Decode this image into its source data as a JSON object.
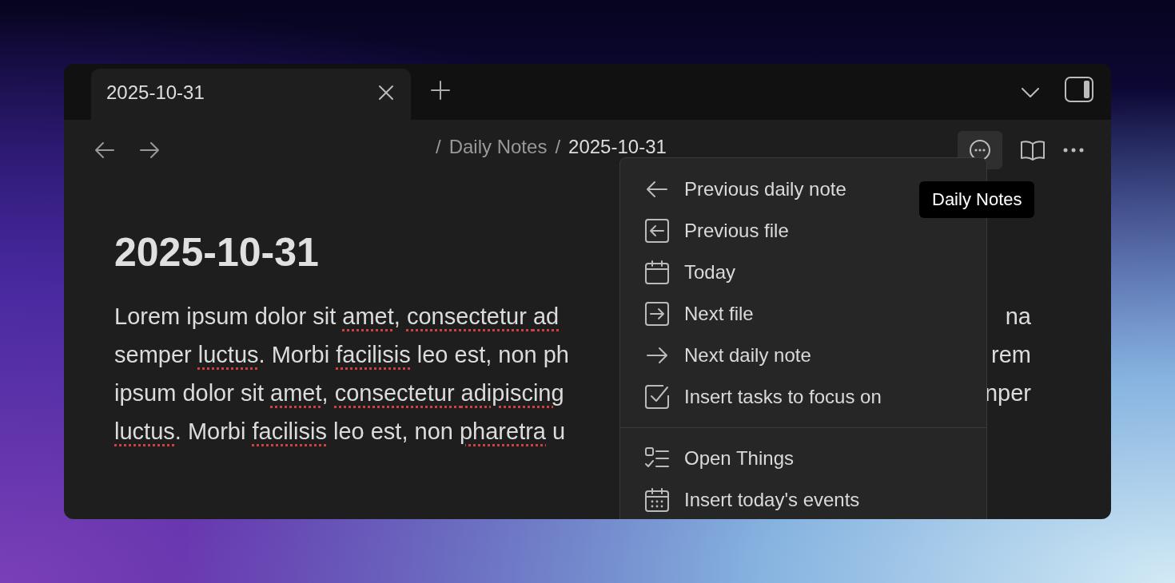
{
  "tabs": [
    {
      "title": "2025-10-31",
      "selected": true
    }
  ],
  "toolbar": {
    "breadcrumb": [
      "/",
      "Daily Notes",
      "/",
      "2025-10-31"
    ],
    "daily_notes_button_active": true,
    "tooltip": "Daily Notes"
  },
  "note": {
    "heading": "2025-10-31",
    "lines": [
      {
        "left": [
          {
            "text": "Lorem ipsum dolor sit ",
            "misspelled": false
          },
          {
            "text": "amet",
            "misspelled": true
          },
          {
            "text": ", ",
            "misspelled": false
          },
          {
            "text": "consectetur ",
            "misspelled": true
          },
          {
            "text": "ad",
            "misspelled": true
          }
        ],
        "right": "na"
      },
      {
        "left": [
          {
            "text": "semper ",
            "misspelled": false
          },
          {
            "text": "luctus",
            "misspelled": true
          },
          {
            "text": ". Morbi ",
            "misspelled": false
          },
          {
            "text": "facilisis",
            "misspelled": true
          },
          {
            "text": " leo est, non ph",
            "misspelled": false
          }
        ],
        "right": "rem"
      },
      {
        "left": [
          {
            "text": "ipsum dolor sit ",
            "misspelled": false
          },
          {
            "text": "amet",
            "misspelled": true
          },
          {
            "text": ", ",
            "misspelled": false
          },
          {
            "text": "consectetur ",
            "misspelled": true
          },
          {
            "text": "adipiscing",
            "misspelled": true
          }
        ],
        "right": "nper"
      },
      {
        "left": [
          {
            "text": "luctus",
            "misspelled": true
          },
          {
            "text": ". Morbi ",
            "misspelled": false
          },
          {
            "text": "facilisis",
            "misspelled": true
          },
          {
            "text": " leo est, non ",
            "misspelled": false
          },
          {
            "text": "pharetra",
            "misspelled": true
          },
          {
            "text": " u",
            "misspelled": false
          }
        ]
      }
    ]
  },
  "menu": {
    "groups": [
      [
        {
          "label": "Previous daily note"
        },
        {
          "label": "Previous file"
        },
        {
          "label": "Today"
        },
        {
          "label": "Next file"
        },
        {
          "label": "Next daily note"
        },
        {
          "label": "Insert tasks to focus on"
        }
      ],
      [
        {
          "label": "Open Things"
        },
        {
          "label": "Insert today's events"
        }
      ]
    ]
  }
}
